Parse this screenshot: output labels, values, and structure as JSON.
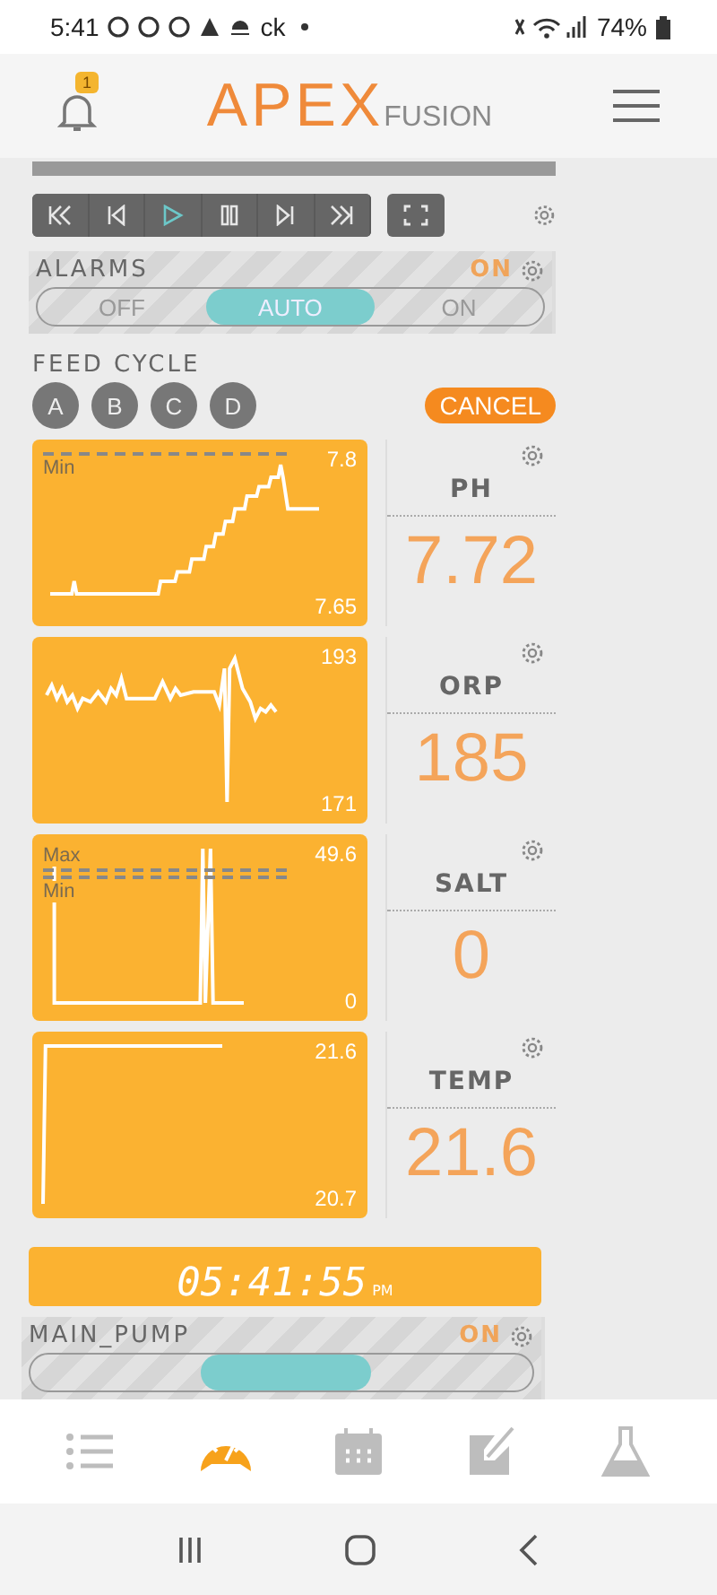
{
  "status_bar": {
    "time": "5:41",
    "carrier": "ck",
    "battery": "74%"
  },
  "header": {
    "notification_count": "1",
    "logo_main": "APEX",
    "logo_sub": "FUSION"
  },
  "playback": {
    "buttons": [
      {
        "kind": "first",
        "selected": false
      },
      {
        "kind": "prev",
        "selected": false
      },
      {
        "kind": "play",
        "selected": true
      },
      {
        "kind": "pause",
        "selected": false
      },
      {
        "kind": "next",
        "selected": false
      },
      {
        "kind": "last",
        "selected": false
      }
    ]
  },
  "alarms": {
    "label": "ALARMS",
    "state": "ON",
    "options": [
      {
        "label": "OFF",
        "selected": false
      },
      {
        "label": "AUTO",
        "selected": true
      },
      {
        "label": "ON",
        "selected": false
      }
    ]
  },
  "feed_cycle": {
    "label": "FEED CYCLE",
    "buttons": [
      "A",
      "B",
      "C",
      "D"
    ],
    "cancel": "CANCEL"
  },
  "probes": [
    {
      "name": "PH",
      "value": "7.72",
      "max": "7.8",
      "min": "7.65",
      "guides": [
        "Min"
      ]
    },
    {
      "name": "ORP",
      "value": "185",
      "max": "193",
      "min": "171"
    },
    {
      "name": "SALT",
      "value": "0",
      "max": "49.6",
      "min": "0",
      "guides": [
        "Max",
        "Min"
      ]
    },
    {
      "name": "TEMP",
      "value": "21.6",
      "max": "21.6",
      "min": "20.7"
    }
  ],
  "clock": {
    "time": "05:41:55",
    "period": "PM"
  },
  "main_pump": {
    "label": "MAIN_PUMP",
    "state": "ON"
  },
  "bottom_nav": [
    {
      "kind": "list",
      "selected": false
    },
    {
      "kind": "gauge",
      "selected": true
    },
    {
      "kind": "calendar",
      "selected": false
    },
    {
      "kind": "edit",
      "selected": false
    },
    {
      "kind": "flask",
      "selected": false
    }
  ]
}
